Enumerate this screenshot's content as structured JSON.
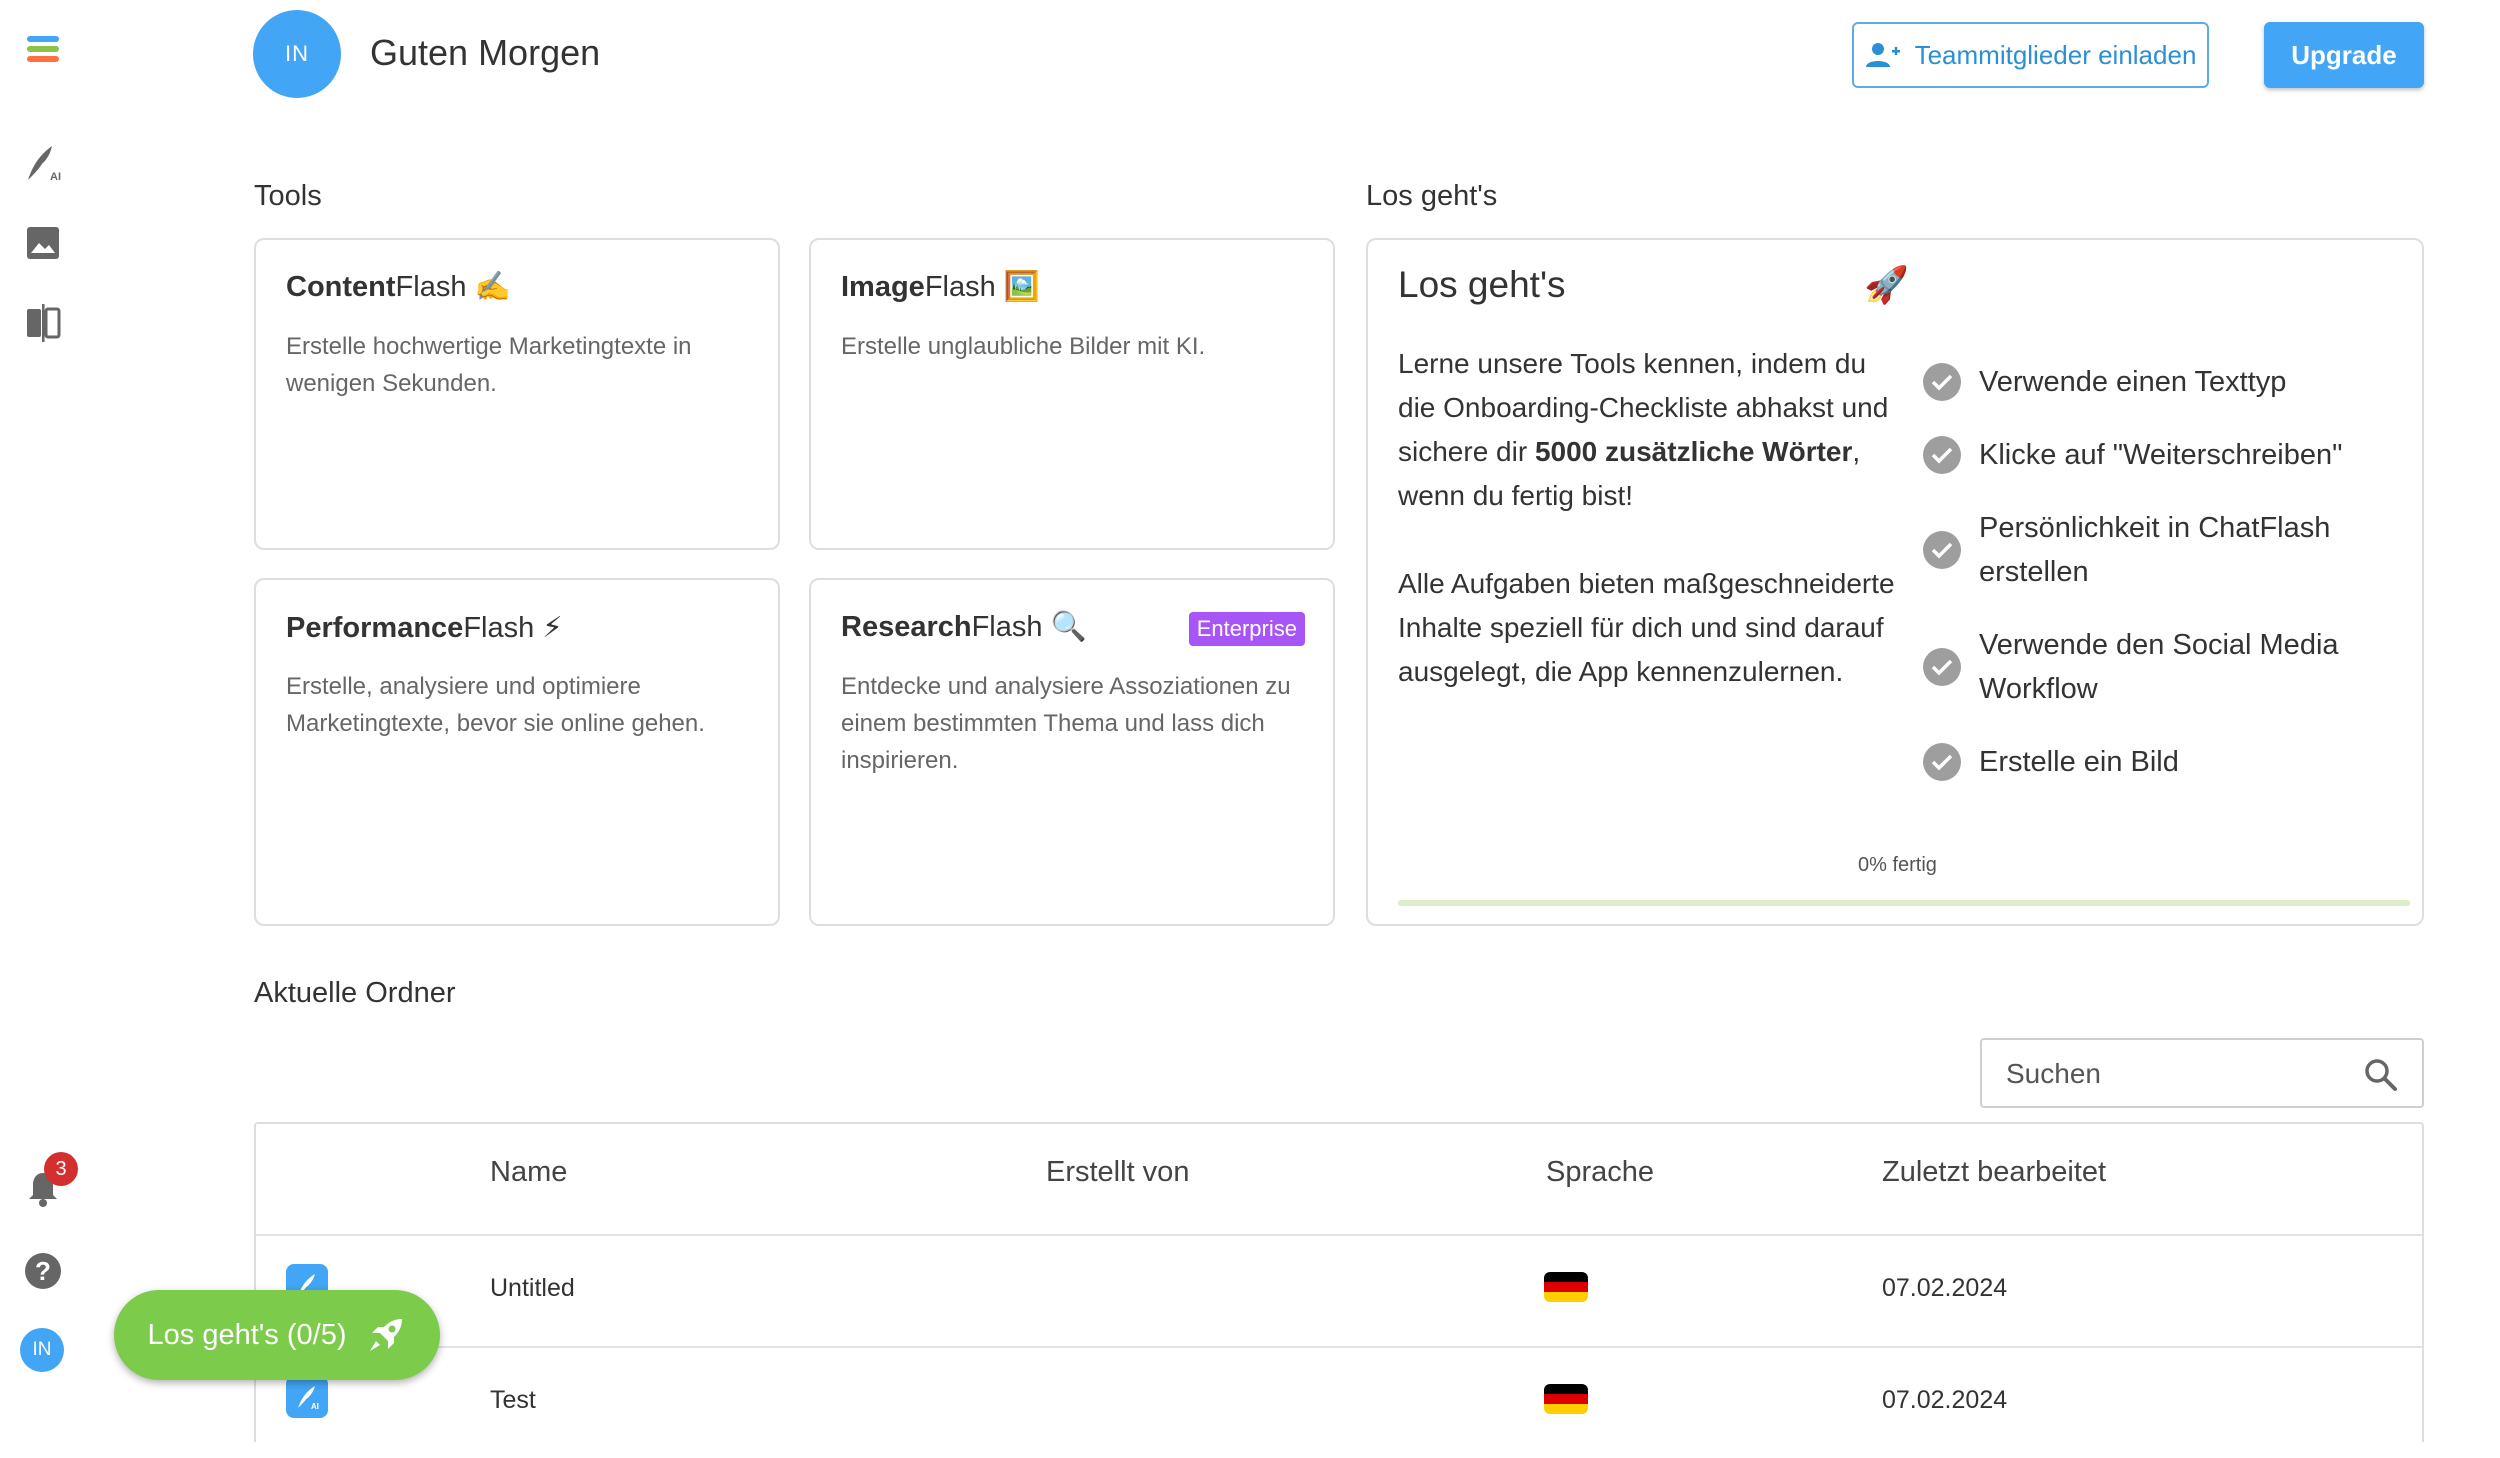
{
  "header": {
    "avatar_initials": "IN",
    "greeting": "Guten Morgen",
    "invite_label": "Teammitglieder einladen",
    "upgrade_label": "Upgrade"
  },
  "tools": {
    "section_title": "Tools",
    "cards": [
      {
        "title_bold": "Content",
        "title_rest": "Flash",
        "emoji": "✍️",
        "desc": "Erstelle hochwertige Marketingtexte in wenigen Sekunden."
      },
      {
        "title_bold": "Image",
        "title_rest": "Flash",
        "emoji": "🖼️",
        "desc": "Erstelle unglaubliche Bilder mit KI."
      },
      {
        "title_bold": "Performance",
        "title_rest": "Flash",
        "emoji": "⚡",
        "desc": "Erstelle, analysiere und optimiere Marketingtexte, bevor sie online gehen."
      },
      {
        "title_bold": "Research",
        "title_rest": "Flash",
        "emoji": "🔍",
        "badge": "Enterprise",
        "desc": "Entdecke und analysiere Assoziationen zu einem bestimmten Thema und lass dich inspirieren."
      }
    ]
  },
  "onboarding": {
    "section_title": "Los geht's",
    "card_title": "Los geht's",
    "rocket": "🚀",
    "text_before": "Lerne unsere Tools kennen, indem du die Onboarding-Checkliste abhakst und sichere dir ",
    "text_bold": "5000 zusätzliche Wörter",
    "text_after": ", wenn du fertig bist!",
    "text2": "Alle Aufgaben bieten maßgeschneiderte Inhalte speziell für dich und sind darauf ausgelegt, die App kennenzulernen.",
    "checklist": [
      "Verwende einen Texttyp",
      "Klicke auf \"Weiterschreiben\"",
      "Persönlichkeit in ChatFlash erstellen",
      "Verwende den Social Media Workflow",
      "Erstelle ein Bild"
    ],
    "progress_label": "0% fertig",
    "progress_value": 0
  },
  "folders": {
    "section_title": "Aktuelle Ordner",
    "search_placeholder": "Suchen",
    "columns": [
      "Name",
      "Erstellt von",
      "Sprache",
      "Zuletzt bearbeitet"
    ],
    "rows": [
      {
        "name": "Untitled",
        "creator": "",
        "language": "de",
        "edited": "07.02.2024"
      },
      {
        "name": "Test",
        "creator": "",
        "language": "de",
        "edited": "07.02.2024"
      }
    ]
  },
  "sidebar": {
    "notification_count": "3",
    "avatar_initials": "IN"
  },
  "fab": {
    "label": "Los geht's (0/5)"
  },
  "colors": {
    "primary": "#42a5f5",
    "fab_green": "#7ccb4a",
    "badge_purple": "#a855f7",
    "notification_red": "#d32f2f"
  }
}
